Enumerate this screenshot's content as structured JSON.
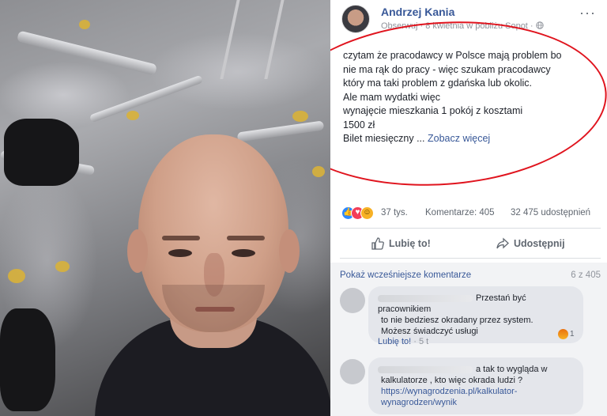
{
  "post": {
    "author": "Andrzej Kania",
    "meta": "Obserwuj · 8 kwietnia w pobliżu Sopot · ",
    "globe_icon": "globe-icon",
    "more_icon": "···",
    "text_lines": [
      "czytam że pracodawcy w Polsce mają problem bo",
      "nie ma rąk do pracy - więc szukam pracodawcy",
      "który ma taki problem z gdańska lub okolic.",
      "Ale mam wydatki więc",
      "wynajęcie mieszkania 1 pokój z kosztami",
      "1500 zł",
      "Bilet miesięczny ... "
    ],
    "see_more": "Zobacz więcej"
  },
  "stats": {
    "reactions": "37 tys.",
    "comments": "Komentarze: 405",
    "shares": "32 475 udostępnień"
  },
  "actions": {
    "like": "Lubię to!",
    "share": "Udostępnij"
  },
  "comments": {
    "show_previous": "Pokaż wcześniejsze komentarze",
    "page_count": "6 z 405",
    "items": [
      {
        "lines": [
          "Przestań być pracownikiem",
          "to nie bedziesz okradany przez system.",
          "Możesz świadczyć usługi"
        ],
        "reaction_count": "1",
        "like_label": "Lubię to!",
        "time": "· 5 t"
      },
      {
        "lines": [
          "a tak to wygląda w",
          "kalkulatorze , kto więc okrada ludzi ?"
        ],
        "link_lines": [
          "https://wynagrodzenia.pl/kalkulator-",
          "wynagrodzen/wynik"
        ]
      }
    ]
  },
  "colors": {
    "link": "#385898",
    "highlight_circle": "#e0141e",
    "like_blue": "#2d88ff"
  }
}
